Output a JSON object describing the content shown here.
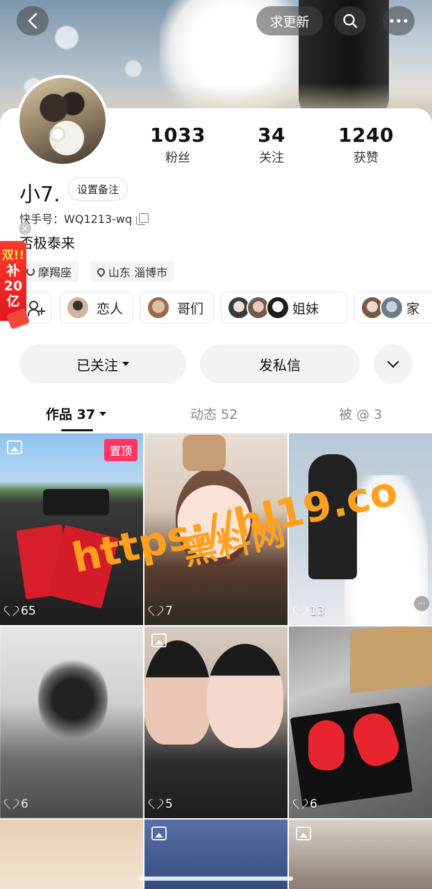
{
  "topbar": {
    "request_update_label": "求更新"
  },
  "profile": {
    "stats": {
      "fans": {
        "value": "1033",
        "label": "粉丝"
      },
      "following": {
        "value": "34",
        "label": "关注"
      },
      "likes": {
        "value": "1240",
        "label": "获赞"
      }
    },
    "name": "小7.",
    "set_remark_label": "设置备注",
    "kuaishou_id": "快手号：WQ1213-wq",
    "bio": "否极泰来",
    "tags": {
      "zodiac": "摩羯座",
      "location": "山东 淄博市"
    }
  },
  "promo": {
    "line1": "双!!",
    "line2": "补",
    "line3": "20",
    "line4": "亿",
    "close": "×"
  },
  "relations": {
    "lover": "恋人",
    "bros": "哥们",
    "sisters": "姐妹",
    "family": "家"
  },
  "actions": {
    "followed_label": "已关注",
    "message_label": "发私信"
  },
  "tabs": {
    "works": "作品 37",
    "moments": "动态 52",
    "mentioned": "被 @ 3"
  },
  "posts": [
    {
      "likes": "65",
      "badge": "置顶"
    },
    {
      "likes": "7"
    },
    {
      "likes": "13"
    },
    {
      "likes": "6"
    },
    {
      "likes": "5"
    },
    {
      "likes": "6"
    }
  ],
  "watermark": {
    "line1": "黑料网",
    "line2": "https://hl19.co"
  },
  "colors": {
    "pinned_badge": "#fe3666",
    "watermark": "#ffa01f",
    "promo_red": "#e0161c"
  }
}
